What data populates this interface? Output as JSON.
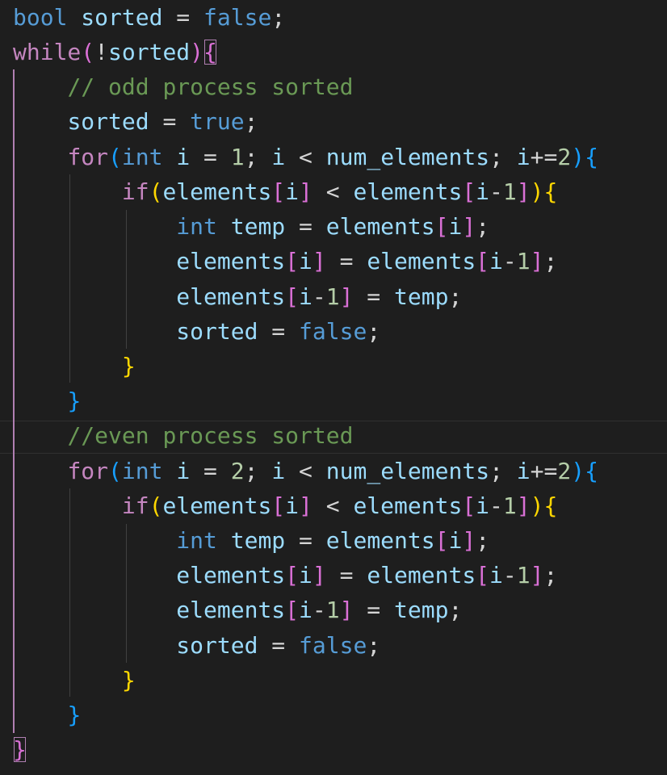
{
  "editor": {
    "language": "cpp",
    "theme": "dark",
    "lines": [
      "bool sorted = false;",
      "while(!sorted){",
      "    // odd process sorted",
      "    sorted = true;",
      "    for(int i = 1; i < num_elements; i+=2){",
      "        if(elements[i] < elements[i-1]){",
      "            int temp = elements[i];",
      "            elements[i] = elements[i-1];",
      "            elements[i-1] = temp;",
      "            sorted = false;",
      "        }",
      "    }",
      "    //even process sorted",
      "    for(int i = 2; i < num_elements; i+=2){",
      "        if(elements[i] < elements[i-1]){",
      "            int temp = elements[i];",
      "            elements[i] = elements[i-1];",
      "            elements[i-1] = temp;",
      "            sorted = false;",
      "        }",
      "    }",
      "}"
    ]
  },
  "tokens": {
    "kw_bool": "bool",
    "kw_while": "while",
    "kw_int": "int",
    "kw_for": "for",
    "kw_if": "if",
    "lit_false": "false",
    "lit_true": "true",
    "var_sorted": "sorted",
    "var_i": "i",
    "var_temp": "temp",
    "var_elements": "elements",
    "var_num_elements": "num_elements",
    "num_1": "1",
    "num_2": "2",
    "comment_odd": "// odd process sorted",
    "comment_even": "//even process sorted"
  },
  "colors": {
    "background": "#1e1e1e",
    "keyword": "#569cd6",
    "control": "#c586c0",
    "variable": "#9cdcfe",
    "number": "#b5cea8",
    "comment": "#6a9955",
    "bracket_level1": "#ffd700",
    "bracket_level2": "#da70d6",
    "bracket_level3": "#179fff"
  }
}
